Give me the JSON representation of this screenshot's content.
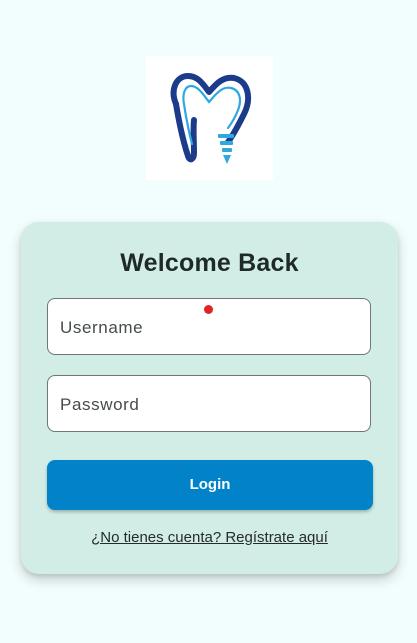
{
  "colors": {
    "page_background": "#f2fdfd",
    "card_background": "#d1ede6",
    "primary_button": "#0283c9",
    "logo_dark_blue": "#1c3b8a",
    "logo_light_blue": "#2fa8e0",
    "cursor_dot": "#e02424"
  },
  "logo": {
    "icon": "tooth-implant-icon"
  },
  "login_card": {
    "title": "Welcome Back",
    "username": {
      "placeholder": "Username",
      "value": ""
    },
    "password": {
      "placeholder": "Password",
      "value": ""
    },
    "login_label": "Login",
    "register_link": "¿No tienes cuenta? Regístrate aquí"
  }
}
